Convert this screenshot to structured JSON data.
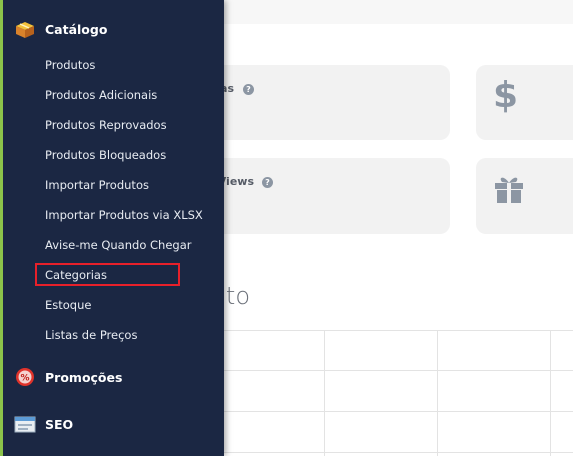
{
  "sidebar": {
    "catalog_section": {
      "label": "Catálogo",
      "icon": "package-box-icon"
    },
    "items": [
      {
        "label": "Produtos"
      },
      {
        "label": "Produtos Adicionais"
      },
      {
        "label": "Produtos Reprovados"
      },
      {
        "label": "Produtos Bloqueados"
      },
      {
        "label": "Importar Produtos"
      },
      {
        "label": "Importar Produtos via XLSX"
      },
      {
        "label": "Avise-me Quando Chegar"
      },
      {
        "label": "Categorias",
        "highlighted": true
      },
      {
        "label": "Estoque"
      },
      {
        "label": "Listas de Preços"
      }
    ],
    "promotions_section": {
      "label": "Promoções",
      "icon": "percent-badge-icon"
    },
    "seo_section": {
      "label": "SEO",
      "icon": "browser-window-icon"
    },
    "accent_color": "#8bc34a",
    "background_color": "#1b2743",
    "highlight_color": "#e8202a"
  },
  "main": {
    "cards": [
      {
        "label_fragment": "as",
        "help": "?"
      },
      {
        "icon": "dollar-icon"
      },
      {
        "label_fragment": "Views",
        "help": "?"
      },
      {
        "icon": "gift-icon"
      }
    ],
    "section_heading_fragment": "to"
  }
}
